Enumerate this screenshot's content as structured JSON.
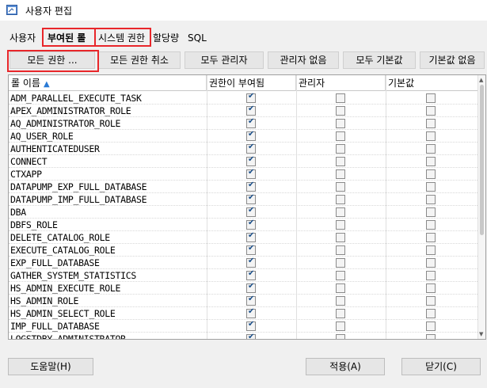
{
  "window": {
    "title": "사용자 편집"
  },
  "tabs": [
    {
      "label": "사용자",
      "active": false
    },
    {
      "label": "부여된 롤",
      "active": true
    },
    {
      "label": "시스템 권한",
      "active": false
    },
    {
      "label": "할당량",
      "active": false
    },
    {
      "label": "SQL",
      "active": false
    }
  ],
  "toolbar": {
    "buttons": [
      "모든 권한 ...",
      "모든 권한 취소",
      "모두 관리자",
      "관리자 없음",
      "모두 기본값",
      "기본값 없음"
    ]
  },
  "grid": {
    "columns": [
      "롤 이름",
      "권한이 부여됨",
      "관리자",
      "기본값"
    ],
    "rows": [
      {
        "name": "ADM_PARALLEL_EXECUTE_TASK",
        "granted": true,
        "admin": false,
        "default": false
      },
      {
        "name": "APEX_ADMINISTRATOR_ROLE",
        "granted": true,
        "admin": false,
        "default": false
      },
      {
        "name": "AQ_ADMINISTRATOR_ROLE",
        "granted": true,
        "admin": false,
        "default": false
      },
      {
        "name": "AQ_USER_ROLE",
        "granted": true,
        "admin": false,
        "default": false
      },
      {
        "name": "AUTHENTICATEDUSER",
        "granted": true,
        "admin": false,
        "default": false
      },
      {
        "name": "CONNECT",
        "granted": true,
        "admin": false,
        "default": false
      },
      {
        "name": "CTXAPP",
        "granted": true,
        "admin": false,
        "default": false
      },
      {
        "name": "DATAPUMP_EXP_FULL_DATABASE",
        "granted": true,
        "admin": false,
        "default": false
      },
      {
        "name": "DATAPUMP_IMP_FULL_DATABASE",
        "granted": true,
        "admin": false,
        "default": false
      },
      {
        "name": "DBA",
        "granted": true,
        "admin": false,
        "default": false
      },
      {
        "name": "DBFS_ROLE",
        "granted": true,
        "admin": false,
        "default": false
      },
      {
        "name": "DELETE_CATALOG_ROLE",
        "granted": true,
        "admin": false,
        "default": false
      },
      {
        "name": "EXECUTE_CATALOG_ROLE",
        "granted": true,
        "admin": false,
        "default": false
      },
      {
        "name": "EXP_FULL_DATABASE",
        "granted": true,
        "admin": false,
        "default": false
      },
      {
        "name": "GATHER_SYSTEM_STATISTICS",
        "granted": true,
        "admin": false,
        "default": false
      },
      {
        "name": "HS_ADMIN_EXECUTE_ROLE",
        "granted": true,
        "admin": false,
        "default": false
      },
      {
        "name": "HS_ADMIN_ROLE",
        "granted": true,
        "admin": false,
        "default": false
      },
      {
        "name": "HS_ADMIN_SELECT_ROLE",
        "granted": true,
        "admin": false,
        "default": false
      },
      {
        "name": "IMP_FULL_DATABASE",
        "granted": true,
        "admin": false,
        "default": false
      },
      {
        "name": "LOGSTDBY_ADMINISTRATOR",
        "granted": true,
        "admin": false,
        "default": false
      }
    ]
  },
  "footer": {
    "help": "도움말(H)",
    "apply": "적용(A)",
    "close": "닫기(C)"
  },
  "colors": {
    "highlight": "#e8262a",
    "check": "#1a4f8a",
    "sort_arrow": "#2a7ad5"
  },
  "icons": [
    "app-icon",
    "sort-asc-icon",
    "checkbox-icon",
    "scroll-up-icon",
    "scroll-down-icon"
  ]
}
